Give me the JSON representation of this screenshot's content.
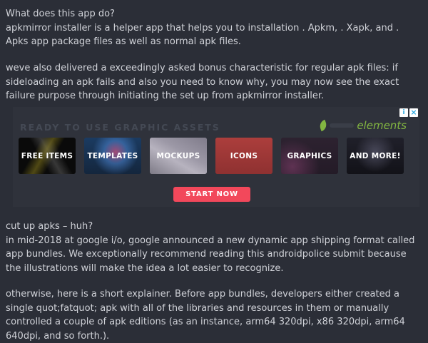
{
  "article": {
    "para1_lines": [
      "What does this app do?",
      "apkmirror installer is a helper app that helps you to installation . Apkm, . Xapk, and . Apks app package files as well as normal apk files."
    ],
    "para2": "weve also delivered a exceedingly asked bonus characteristic for regular apk files: if sideloading an apk fails and also you need to know why, you may now see the exact failure purpose through initiating the set up from apkmirror installer.",
    "para3_lines": [
      "cut up apks – huh?",
      "in mid-2018 at google i/o, google announced a new dynamic app shipping format called app bundles. We exceptionally recommend reading this androidpolice submit because the illustrations will make the idea a lot easier to recognize."
    ],
    "para4": "otherwise, here is a short explainer. Before app bundles, developers either created a single quot;fatquot; apk with all of the libraries and resources in them or manually controlled a couple of apk editions (as an instance, arm64 320dpi, x86 320dpi, arm64 640dpi, and so forth.)."
  },
  "ad": {
    "headline": "READY TO USE GRAPHIC ASSETS",
    "logo_text": "elements",
    "info_glyph": "i",
    "close_glyph": "×",
    "tiles": [
      {
        "label": "FREE ITEMS"
      },
      {
        "label": "TEMPLATES"
      },
      {
        "label": "MOCKUPS"
      },
      {
        "label": "ICONS"
      },
      {
        "label": "GRAPHICS"
      },
      {
        "label": "AND MORE!"
      }
    ],
    "cta": "START NOW"
  },
  "colors": {
    "background": "#2b2e37",
    "text": "#d0d2d8",
    "cta": "#f2485b",
    "brand_green": "#82b541"
  }
}
